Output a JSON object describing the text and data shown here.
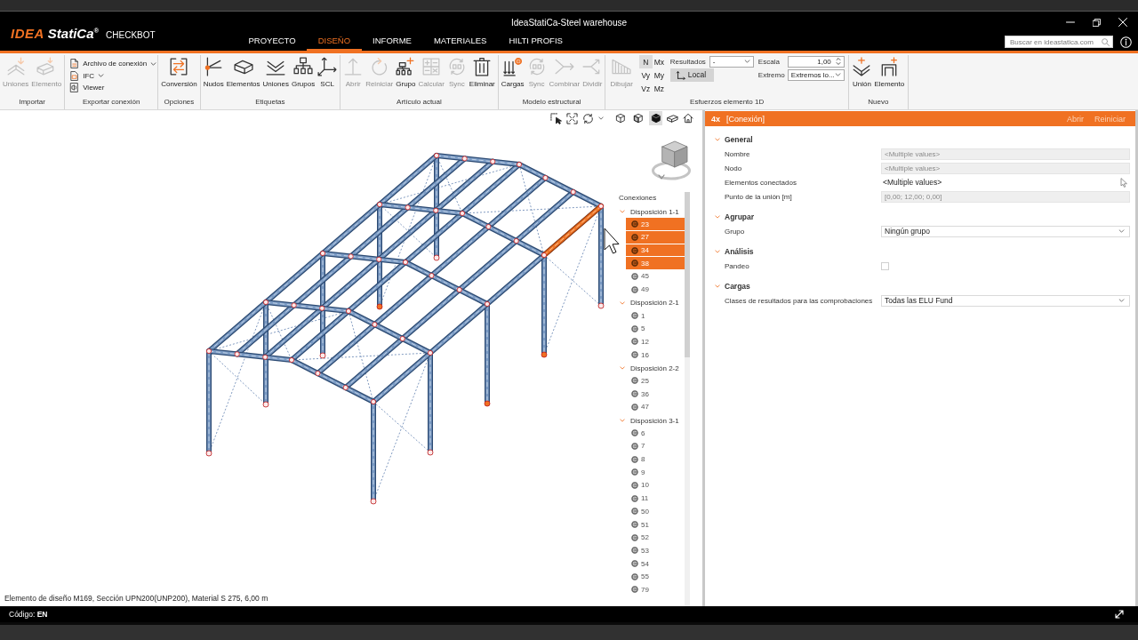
{
  "window": {
    "title": "IdeaStatiCa-Steel warehouse"
  },
  "app": {
    "logo_mark": "IDEA",
    "logo_name": "StatiCa$^{®}$",
    "product": "CHECKBOT"
  },
  "tabs": [
    {
      "label": "PROYECTO",
      "selected": false
    },
    {
      "label": "DISEÑO",
      "selected": true
    },
    {
      "label": "INFORME",
      "selected": false
    },
    {
      "label": "MATERIALES",
      "selected": false
    },
    {
      "label": "HILTI PROFIS",
      "selected": false
    }
  ],
  "search": {
    "placeholder": "Buscar en ideastatica.com"
  },
  "ribbon": {
    "groups": [
      {
        "label": "Importar",
        "items": [
          {
            "kind": "large",
            "label": "Uniones",
            "disabled": true
          },
          {
            "kind": "large",
            "label": "Elemento",
            "disabled": true
          }
        ]
      },
      {
        "label": "Exportar conexión",
        "items": [
          {
            "kind": "small",
            "label": "Archivo de conexión",
            "dropdown": true
          },
          {
            "kind": "small",
            "label": "IFC",
            "dropdown": true
          },
          {
            "kind": "small",
            "label": "Viewer",
            "dropdown": false
          }
        ]
      },
      {
        "label": "Opciones",
        "items": [
          {
            "kind": "large",
            "label": "Conversión",
            "disabled": false
          }
        ]
      },
      {
        "label": "Etiquetas",
        "items": [
          {
            "kind": "large",
            "label": "Nudos",
            "disabled": false
          },
          {
            "kind": "large",
            "label": "Elementos",
            "disabled": false
          },
          {
            "kind": "large",
            "label": "Uniones",
            "disabled": false
          },
          {
            "kind": "large",
            "label": "Grupos",
            "disabled": false
          },
          {
            "kind": "large",
            "label": "SCL",
            "disabled": false
          }
        ]
      },
      {
        "label": "Artículo actual",
        "items": [
          {
            "kind": "large",
            "label": "Abrir",
            "disabled": true
          },
          {
            "kind": "large",
            "label": "Reiniciar",
            "disabled": true
          },
          {
            "kind": "large",
            "label": "Grupo",
            "disabled": false
          },
          {
            "kind": "large",
            "label": "Calcular",
            "disabled": true
          },
          {
            "kind": "large",
            "label": "Sync",
            "disabled": true
          },
          {
            "kind": "large",
            "label": "Eliminar",
            "disabled": false
          }
        ]
      },
      {
        "label": "Modelo estructural",
        "items": [
          {
            "kind": "large",
            "label": "Cargas",
            "disabled": false
          },
          {
            "kind": "large",
            "label": "Sync",
            "disabled": true
          },
          {
            "kind": "large",
            "label": "Combinar",
            "disabled": true
          },
          {
            "kind": "large",
            "label": "Dividir",
            "disabled": true
          }
        ]
      },
      {
        "label": "Esfuerzos elemento 1D",
        "items": [
          {
            "kind": "large",
            "label": "Dibujar",
            "disabled": true
          },
          {
            "kind": "toggles",
            "toggles": [
              {
                "label": "N",
                "selected": true
              },
              {
                "label": "Mx",
                "selected": false
              },
              {
                "label": "Vy",
                "selected": false
              },
              {
                "label": "My",
                "selected": false
              },
              {
                "label": "Vz",
                "selected": false
              },
              {
                "label": "Mz",
                "selected": false
              }
            ]
          },
          {
            "kind": "fields",
            "fields": [
              {
                "kind": "select",
                "label": "Resultados",
                "value": "-"
              },
              {
                "kind": "toggle",
                "label": "Local",
                "selected": true
              }
            ]
          },
          {
            "kind": "fields",
            "fields": [
              {
                "kind": "spinner",
                "label": "Escala",
                "value": "1,00"
              },
              {
                "kind": "select",
                "label": "Extremo",
                "value": "Extremos lo..."
              }
            ]
          }
        ]
      },
      {
        "label": "Nuevo",
        "items": [
          {
            "kind": "large",
            "label": "Unión",
            "disabled": false
          },
          {
            "kind": "large",
            "label": "Elemento",
            "disabled": false
          }
        ]
      }
    ]
  },
  "viewport": {
    "render_modes": [
      {
        "selected": false
      },
      {
        "selected": false
      },
      {
        "selected": true
      }
    ],
    "tree": {
      "title": "Conexiones",
      "groups": [
        {
          "label": "Disposición 1-1",
          "expanded": true,
          "children": [
            {
              "label": "23",
              "selected": true
            },
            {
              "label": "27",
              "selected": true
            },
            {
              "label": "34",
              "selected": true
            },
            {
              "label": "38",
              "selected": true
            },
            {
              "label": "45",
              "selected": false
            },
            {
              "label": "49",
              "selected": false
            }
          ]
        },
        {
          "label": "Disposición 2-1",
          "expanded": true,
          "children": [
            {
              "label": "1",
              "selected": false
            },
            {
              "label": "5",
              "selected": false
            },
            {
              "label": "12",
              "selected": false
            },
            {
              "label": "16",
              "selected": false
            }
          ]
        },
        {
          "label": "Disposición 2-2",
          "expanded": true,
          "children": [
            {
              "label": "25",
              "selected": false
            },
            {
              "label": "36",
              "selected": false
            },
            {
              "label": "47",
              "selected": false
            }
          ]
        },
        {
          "label": "Disposición 3-1",
          "expanded": true,
          "children": [
            {
              "label": "6",
              "selected": false
            },
            {
              "label": "7",
              "selected": false
            },
            {
              "label": "8",
              "selected": false
            },
            {
              "label": "9",
              "selected": false
            },
            {
              "label": "10",
              "selected": false
            },
            {
              "label": "11",
              "selected": false
            },
            {
              "label": "50",
              "selected": false
            },
            {
              "label": "51",
              "selected": false
            },
            {
              "label": "52",
              "selected": false
            },
            {
              "label": "53",
              "selected": false
            },
            {
              "label": "54",
              "selected": false
            },
            {
              "label": "55",
              "selected": false
            },
            {
              "label": "79",
              "selected": false
            }
          ]
        }
      ]
    },
    "status": "Elemento de diseño M169, Sección UPN200(UNP200), Material S 275, 6,00 m"
  },
  "properties": {
    "count": "4x",
    "title": "[Conexión]",
    "actions": [
      {
        "label": "Abrir",
        "disabled": true
      },
      {
        "label": "Reiniciar",
        "disabled": true
      }
    ],
    "sections": [
      {
        "title": "General",
        "expanded": true,
        "rows": [
          {
            "label": "Nombre",
            "kind": "readonly",
            "value": "<Multiple values>"
          },
          {
            "label": "Nodo",
            "kind": "readonly",
            "value": "<Multiple values>"
          },
          {
            "label": "Elementos conectados",
            "kind": "picker",
            "value": "<Multiple values>"
          },
          {
            "label": "Punto de la unión [m]",
            "kind": "readonly",
            "value": "[0,00; 12,00; 0,00]"
          }
        ]
      },
      {
        "title": "Agrupar",
        "expanded": true,
        "rows": [
          {
            "label": "Grupo",
            "kind": "select",
            "value": "Ningún grupo"
          }
        ]
      },
      {
        "title": "Análisis",
        "expanded": true,
        "rows": [
          {
            "label": "Pandeo",
            "kind": "checkbox",
            "checked": false
          }
        ]
      },
      {
        "title": "Cargas",
        "expanded": true,
        "rows": [
          {
            "label": "Clases de resultados para las comprobaciones",
            "kind": "select",
            "value": "Todas las ELU Fund"
          }
        ]
      }
    ]
  },
  "status_bar": {
    "code": "Código: **EN**"
  }
}
